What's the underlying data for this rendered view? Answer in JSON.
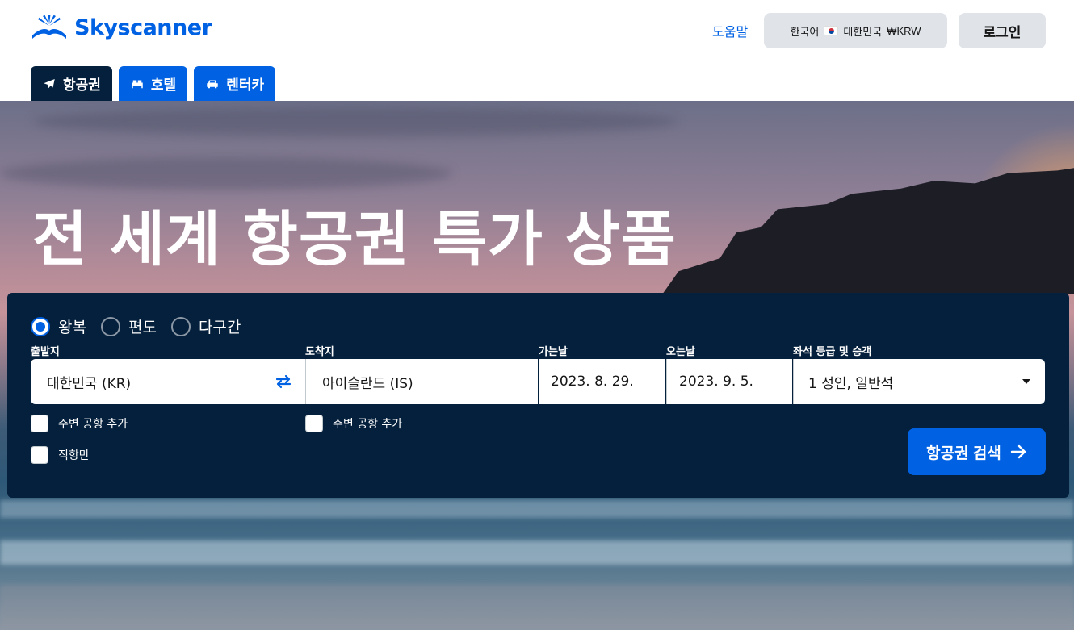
{
  "header": {
    "logo_text": "Skyscanner",
    "help_label": "도움말",
    "locale": {
      "language": "한국어",
      "country": "대한민국",
      "currency": "₩KRW"
    },
    "login_label": "로그인"
  },
  "tabs": [
    {
      "label": "항공권",
      "icon": "plane-icon",
      "active": true
    },
    {
      "label": "호텔",
      "icon": "bed-icon",
      "active": false
    },
    {
      "label": "렌터카",
      "icon": "car-icon",
      "active": false
    }
  ],
  "hero": {
    "title": "전 세계 항공권 특가 상품"
  },
  "search": {
    "trip_types": [
      {
        "label": "왕복",
        "selected": true
      },
      {
        "label": "편도",
        "selected": false
      },
      {
        "label": "다구간",
        "selected": false
      }
    ],
    "origin": {
      "label": "출발지",
      "value": "대한민국 (KR)"
    },
    "destination": {
      "label": "도착지",
      "value": "아이슬란드 (IS)"
    },
    "depart": {
      "label": "가는날",
      "value": "2023. 8. 29."
    },
    "return": {
      "label": "오는날",
      "value": "2023. 9. 5."
    },
    "cabin": {
      "label": "좌석 등급 및 승객",
      "value": "1 성인, 일반석"
    },
    "origin_nearby": "주변 공항 추가",
    "destination_nearby": "주변 공항 추가",
    "direct_only": "직항만",
    "search_button": "항공권 검색"
  },
  "colors": {
    "brand_blue": "#0062e3",
    "panel_navy": "#05203c",
    "button_grey": "#e0e4e9"
  }
}
